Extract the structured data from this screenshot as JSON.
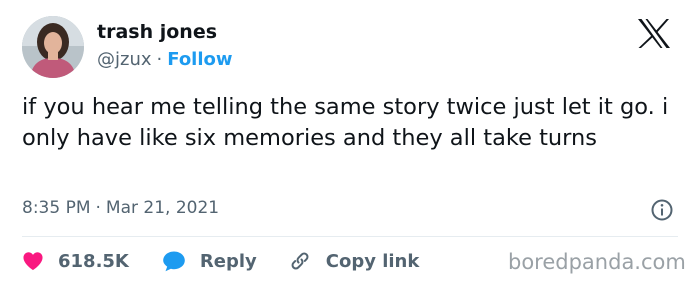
{
  "author": {
    "name": "trash jones",
    "handle": "@jzux",
    "separator": "·",
    "follow_label": "Follow",
    "avatar_icon": "avatar-photo"
  },
  "platform_logo": "x-logo-icon",
  "tweet": {
    "text": "if you hear me telling the same story twice just let it go. i only have like six memories and they all take turns",
    "time": "8:35 PM",
    "separator": "·",
    "date": "Mar 21, 2021"
  },
  "actions": {
    "likes": "618.5K",
    "reply_label": "Reply",
    "copy_link_label": "Copy link"
  },
  "watermark": "boredpanda.com",
  "colors": {
    "accent": "#1d9bf0",
    "like": "#f91880",
    "text": "#0f1419",
    "secondary": "#536471"
  }
}
